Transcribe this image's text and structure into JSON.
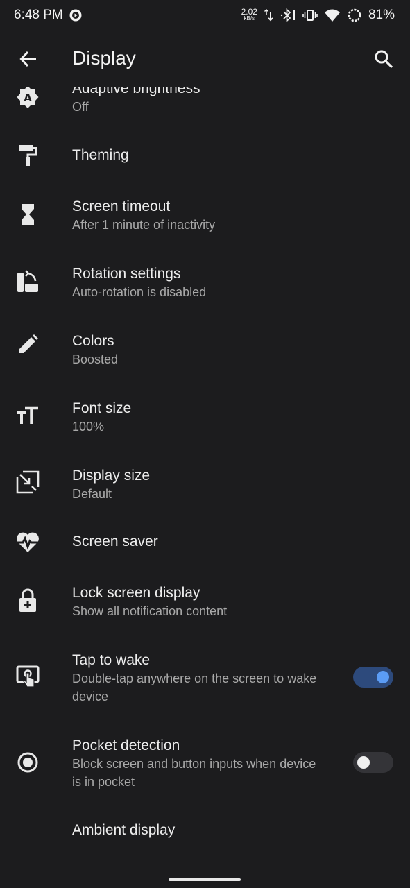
{
  "status_bar": {
    "time": "6:48 PM",
    "net_speed_value": "2.02",
    "net_speed_unit": "kB/s",
    "battery": "81%",
    "icons": [
      "media-playing-icon",
      "data-transfer-icon",
      "bluetooth-icon",
      "vibrate-icon",
      "wifi-icon",
      "battery-saver-icon"
    ]
  },
  "app_bar": {
    "title": "Display",
    "back_icon": "arrow-back-icon",
    "search_icon": "search-icon"
  },
  "items": [
    {
      "title": "Adaptive brightness",
      "subtitle": "Off",
      "icon": "brightness-auto-icon"
    },
    {
      "title": "Theming",
      "subtitle": "",
      "icon": "paint-roller-icon"
    },
    {
      "title": "Screen timeout",
      "subtitle": "After 1 minute of inactivity",
      "icon": "hourglass-icon"
    },
    {
      "title": "Rotation settings",
      "subtitle": "Auto-rotation is disabled",
      "icon": "screen-rotation-icon"
    },
    {
      "title": "Colors",
      "subtitle": "Boosted",
      "icon": "pencil-icon"
    },
    {
      "title": "Font size",
      "subtitle": "100%",
      "icon": "font-size-icon"
    },
    {
      "title": "Display size",
      "subtitle": "Default",
      "icon": "display-size-icon"
    },
    {
      "title": "Screen saver",
      "subtitle": "",
      "icon": "heartbeat-icon"
    },
    {
      "title": "Lock screen display",
      "subtitle": "Show all notification content",
      "icon": "lock-add-icon"
    },
    {
      "title": "Tap to wake",
      "subtitle": "Double-tap anywhere on the screen to wake device",
      "icon": "tap-screen-icon",
      "toggle": true
    },
    {
      "title": "Pocket detection",
      "subtitle": "Block screen and button inputs when device is in pocket",
      "icon": "radio-target-icon",
      "toggle": false
    },
    {
      "title": "Ambient display",
      "subtitle": "",
      "icon": ""
    }
  ],
  "colors": {
    "background": "#1c1c1e",
    "accent": "#5b9cf5",
    "text_primary": "#ededed",
    "text_secondary": "#a9a9a9"
  }
}
